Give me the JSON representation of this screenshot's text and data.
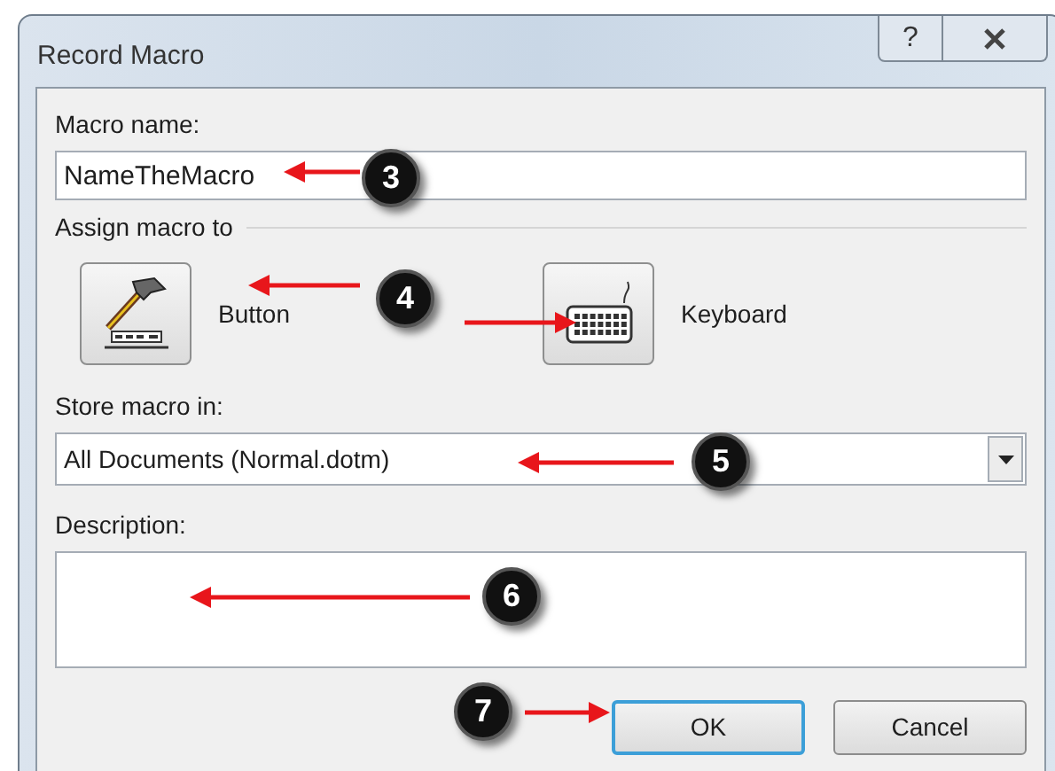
{
  "window": {
    "title": "Record Macro",
    "help_button": "?"
  },
  "macro_name": {
    "label": "Macro name:",
    "value": "NameTheMacro"
  },
  "assign": {
    "label": "Assign macro to",
    "options": [
      {
        "kind": "button",
        "label": "Button"
      },
      {
        "kind": "keyboard",
        "label": "Keyboard"
      }
    ]
  },
  "store": {
    "label": "Store macro in:",
    "value": "All Documents (Normal.dotm)"
  },
  "description": {
    "label": "Description:"
  },
  "buttons": [
    {
      "label": "OK",
      "default": true
    },
    {
      "label": "Cancel",
      "default": false
    }
  ],
  "callouts": [
    {
      "label": "3"
    },
    {
      "label": "4"
    },
    {
      "label": "5"
    },
    {
      "label": "6"
    },
    {
      "label": "7"
    }
  ]
}
